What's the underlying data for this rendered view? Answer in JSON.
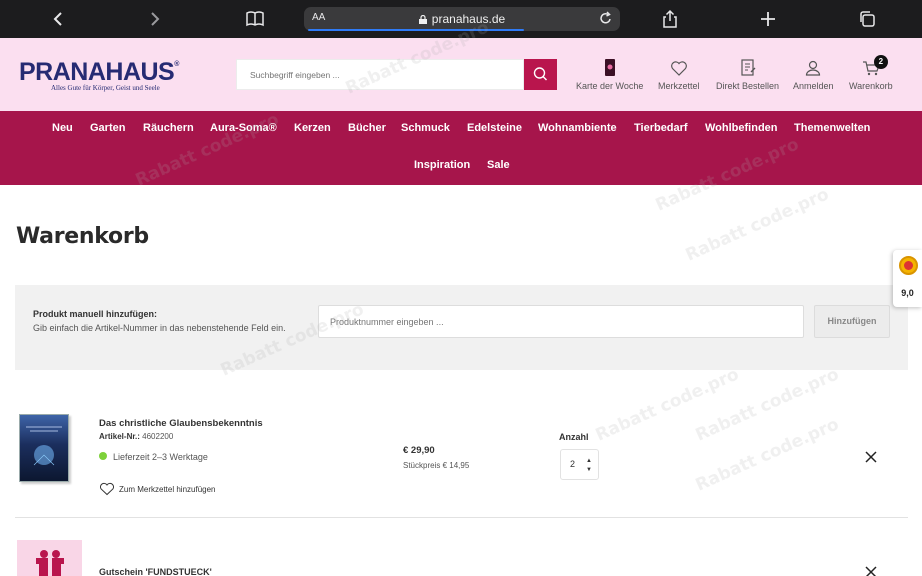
{
  "browser": {
    "text_size_label": "AA",
    "url": "pranahaus.de",
    "icons": [
      "back-icon",
      "forward-icon",
      "bookmarks-icon",
      "share-icon",
      "new-tab-icon",
      "tabs-icon",
      "reload-icon",
      "lock-icon"
    ],
    "load_progress": 0.7
  },
  "header": {
    "logo_title": "PRANAHAUS",
    "logo_mark": "®",
    "logo_tagline": "Alles Gute für Körper, Geist und Seele",
    "search_placeholder": "Suchbegriff eingeben ...",
    "actions": {
      "card_of_week": "Karte der Woche",
      "wishlist": "Merkzettel",
      "direct_order": "Direkt Bestellen",
      "login": "Anmelden",
      "cart": "Warenkorb",
      "cart_count": "2"
    }
  },
  "nav": {
    "row1": [
      "Neu",
      "Garten",
      "Räuchern",
      "Aura-Soma®",
      "Kerzen",
      "Bücher",
      "Schmuck",
      "Edelsteine",
      "Wohnambiente",
      "Tierbedarf",
      "Wohlbefinden",
      "Themenwelten"
    ],
    "row2": [
      "Inspiration",
      "Sale"
    ]
  },
  "page": {
    "title": "Warenkorb"
  },
  "manual_add": {
    "title": "Produkt manuell hinzufügen:",
    "description": "Gib einfach die Artikel-Nummer in das nebenstehende Feld ein.",
    "input_placeholder": "Produktnummer eingeben ...",
    "button_label": "Hinzufügen"
  },
  "cart_items": [
    {
      "name": "Das christliche Glaubensbekenntnis",
      "article_label": "Artikel-Nr.:",
      "article_number": "4602200",
      "delivery": "Lieferzeit 2–3 Werktage",
      "wishlist_link": "Zum Merkzettel hinzufügen",
      "price": "€ 29,90",
      "unit_price": "Stückpreis € 14,95",
      "quantity_label": "Anzahl",
      "quantity": "2"
    },
    {
      "name": "Gutschein 'FUNDSTUECK'"
    }
  ],
  "rating_widget": {
    "score": "9,0"
  },
  "watermark_text": "Rabatt code.pro",
  "colors": {
    "header_bg": "#fbdff0",
    "brand_magenta": "#a6154b",
    "search_button": "#b9154d",
    "logo_navy": "#262b73",
    "stock_green": "#7dd13a"
  }
}
